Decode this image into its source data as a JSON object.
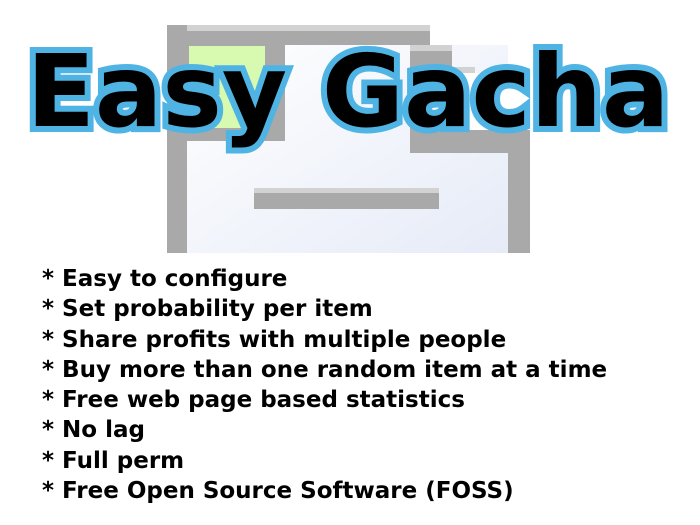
{
  "title": "Easy Gacha",
  "colors": {
    "title_fill": "#000000",
    "title_outline": "#4fb4e3",
    "icon_frame": "#a9a9a9",
    "icon_green": "#d8f9b0"
  },
  "icon": "window-layout-icon",
  "features": [
    "* Easy to configure",
    "* Set probability per item",
    "* Share profits with multiple people",
    "* Buy more than one random item at a time",
    "* Free web page based statistics",
    "* No lag",
    "* Full perm",
    "* Free Open Source Software (FOSS)"
  ]
}
